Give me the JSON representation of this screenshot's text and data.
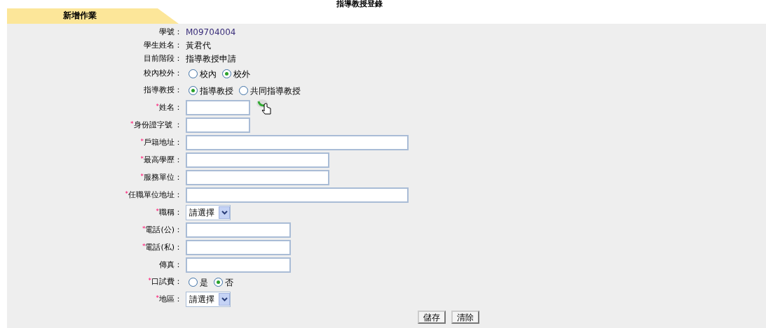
{
  "page_title": "指導教授登錄",
  "tab": {
    "label": "新增作業"
  },
  "fields": [
    {
      "kind": "text",
      "label": "學號：",
      "value": "M09704004"
    },
    {
      "kind": "text",
      "label": "學生姓名：",
      "value": "黃君代"
    },
    {
      "kind": "text",
      "label": "目前階段：",
      "value": "指導教授申請"
    },
    {
      "kind": "radio",
      "label": "校內校外：",
      "options": [
        {
          "label": "校內",
          "selected": false
        },
        {
          "label": "校外",
          "selected": true
        }
      ]
    },
    {
      "kind": "radio",
      "label": "指導教授：",
      "options": [
        {
          "label": "指導教授",
          "selected": true
        },
        {
          "label": "共同指導教授",
          "selected": false
        }
      ]
    },
    {
      "kind": "short-input",
      "label": "姓名：",
      "required_mark": "*",
      "lookup": true
    },
    {
      "kind": "short-input",
      "label": "身份證字號 ：",
      "required_mark": "*"
    },
    {
      "kind": "long-input",
      "label": "戶籍地址：",
      "required_mark": "*"
    },
    {
      "kind": "medium-input",
      "label": "最高學歷：",
      "required_mark": "*"
    },
    {
      "kind": "medium-input",
      "label": "服務單位：",
      "required_mark": "*"
    },
    {
      "kind": "long-input",
      "label": "任職單位地址：",
      "required_mark": "*"
    },
    {
      "kind": "select",
      "label": "職稱：",
      "required_mark": "*",
      "value": "請選擇"
    },
    {
      "kind": "phone-input",
      "label": "電話(公)：",
      "required_mark": "*"
    },
    {
      "kind": "phone-input",
      "label": "電話(私)：",
      "required_mark": "*"
    },
    {
      "kind": "phone-input",
      "label": "傳真："
    },
    {
      "kind": "radio",
      "label": "口試費：",
      "required_mark": "*",
      "options": [
        {
          "label": "是",
          "selected": false
        },
        {
          "label": "否",
          "selected": true
        }
      ]
    },
    {
      "kind": "select",
      "label": "地區：",
      "required_mark": "*",
      "value": "請選擇"
    }
  ],
  "buttons": [
    "儲存",
    "清除"
  ]
}
